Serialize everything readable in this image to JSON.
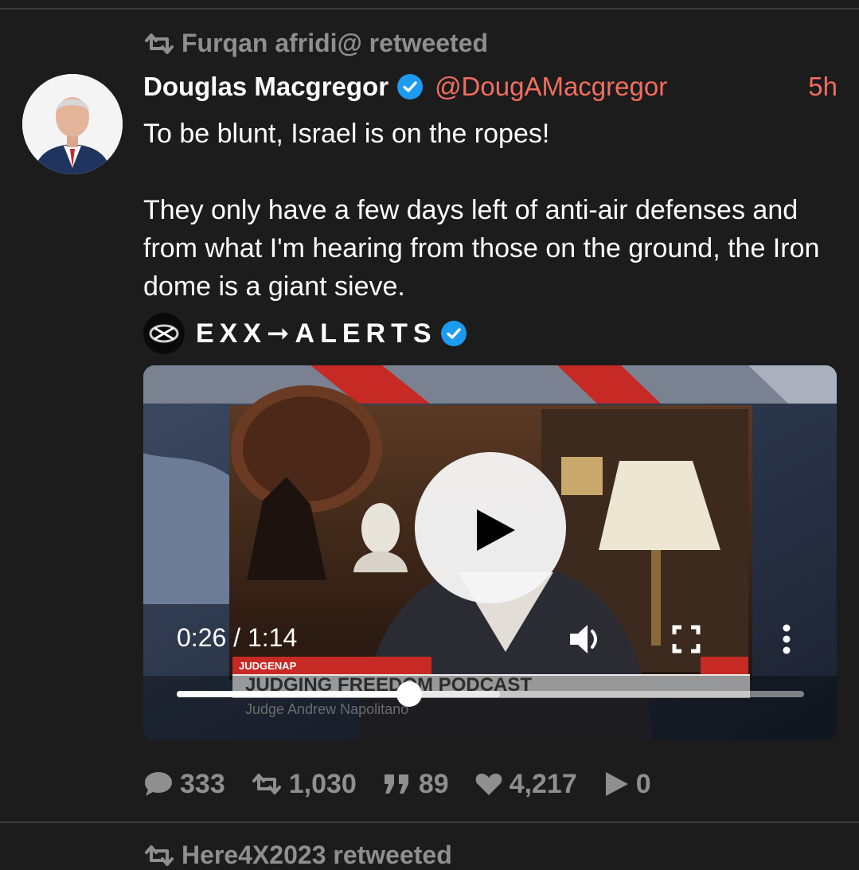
{
  "tweet": {
    "retweeted_by": "Furqan afridi@ retweeted",
    "display_name": "Douglas Macgregor",
    "handle": "@DougAMacgregor",
    "time": "5h",
    "text": "To be blunt, Israel is on the ropes!\n\nThey only have a few days left of anti-air defenses and from what I'm hearing from those on the ground, the Iron dome is a giant sieve.",
    "quoted_account": "EXX➞ALERTS",
    "video": {
      "time_display": "0:26 / 1:14",
      "progress": 0.37,
      "buffered": 0.515,
      "lower_third_tag": "JUDGENAP",
      "lower_third_title": "JUDGING FREEDOM PODCAST",
      "lower_third_subtitle": "Judge Andrew Napolitano"
    },
    "stats": {
      "replies": "333",
      "retweets": "1,030",
      "quotes": "89",
      "likes": "4,217",
      "views": "0"
    }
  },
  "next_tweet": {
    "retweeted_by": "Here4X2023 retweeted"
  },
  "colors": {
    "background": "#1c1c1c",
    "accent": "#f36d5e",
    "muted": "#8f8f8f",
    "verified": "#1d9bf0"
  }
}
